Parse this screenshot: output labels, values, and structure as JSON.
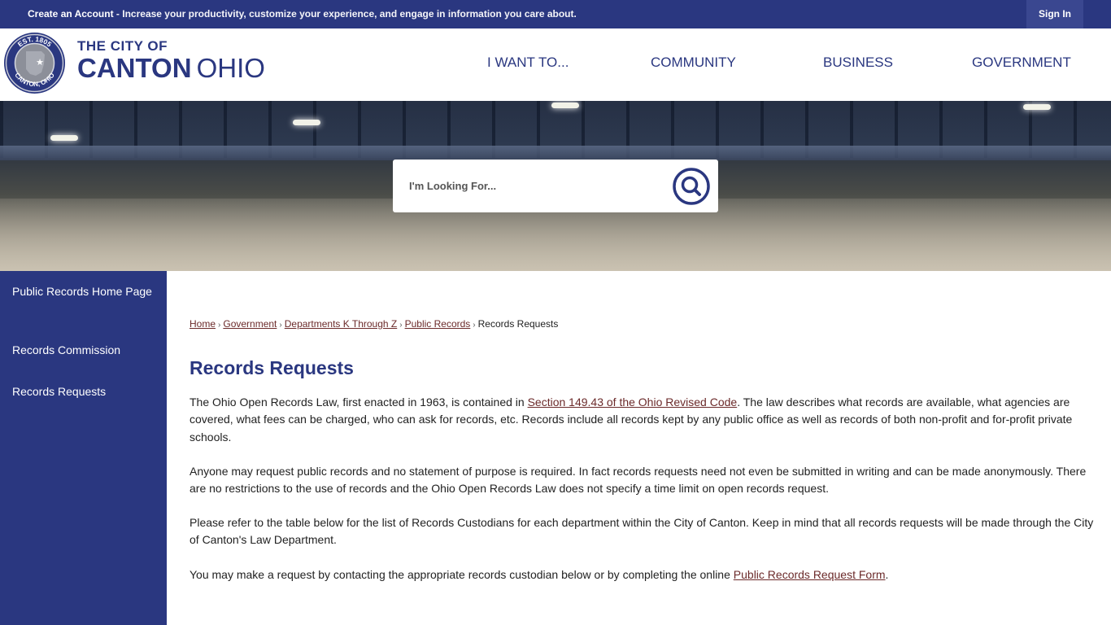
{
  "topbar": {
    "create_account": "Create an Account",
    "create_account_desc": " - Increase your productivity, customize your experience, and engage in information you care about.",
    "sign_in": "Sign In"
  },
  "header": {
    "seal_top": "EST. 1805",
    "seal_bottom": "CANTON, OHIO",
    "logo_small": "THE CITY OF",
    "logo_bold": "CANTON",
    "logo_light": "OHIO",
    "nav": [
      "I WANT TO...",
      "COMMUNITY",
      "BUSINESS",
      "GOVERNMENT"
    ]
  },
  "search": {
    "placeholder": "I'm Looking For..."
  },
  "sidebar": {
    "items": [
      {
        "label": "Public Records Home Page"
      },
      {
        "label": "Records Commission"
      },
      {
        "label": "Records Requests"
      }
    ]
  },
  "breadcrumb": {
    "items": [
      "Home",
      "Government",
      "Departments K Through Z",
      "Public Records"
    ],
    "current": "Records Requests",
    "separator": "›"
  },
  "main": {
    "title": "Records Requests",
    "p1_before": "The Ohio Open Records Law, first enacted in 1963, is contained in ",
    "p1_link": "Section 149.43 of the Ohio Revised Code",
    "p1_after": ". The law describes what records are available, what agencies are covered, what fees can be charged, who can ask for records, etc. Records include all records kept by any public office as well as records of both non-profit and for-profit private schools.",
    "p2": "Anyone may request public records and no statement of purpose is required. In fact records requests need not even be submitted in writing and can be made anonymously. There are no restrictions to the use of records and the Ohio Open Records Law does not specify a time limit on open records request.",
    "p3": "Please refer to the table below for the list of Records Custodians for each department within the City of Canton.  Keep in mind that all records requests will be made through the City of Canton's Law Department.",
    "p4_before": "You may make a request by contacting the appropriate records custodian below or by completing the online ",
    "p4_link": "Public Records Request Form",
    "p4_after": "."
  },
  "colors": {
    "brand_navy": "#2a3780",
    "link": "#6b2a2a"
  }
}
